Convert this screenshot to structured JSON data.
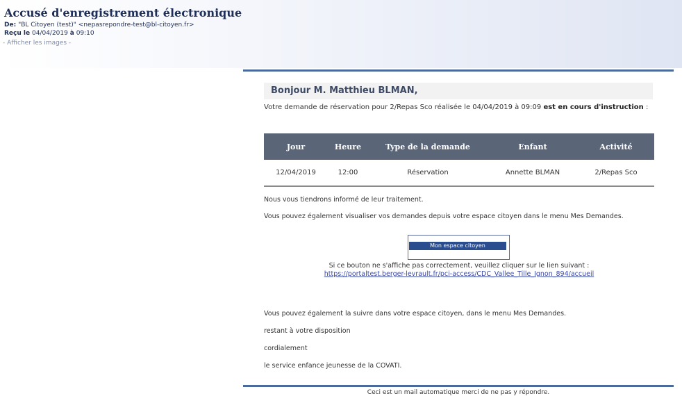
{
  "header": {
    "subject": "Accusé d'enregistrement électronique",
    "from_label": "De:",
    "from_value": "\"BL Citoyen (test)\" <nepasrepondre-test@bl-citoyen.fr>",
    "received_label": "Reçu le",
    "received_date": "04/04/2019",
    "received_at_label": "à",
    "received_time": "09:10",
    "show_images": "- Afficher les images -"
  },
  "mail": {
    "greeting": "Bonjour M. Matthieu BLMAN,",
    "intro_text": "Votre demande de réservation pour 2/Repas Sco réalisée le 04/04/2019 à 09:09",
    "intro_bold": "est en cours d'instruction",
    "intro_end": " :",
    "table": {
      "headers": [
        "Jour",
        "Heure",
        "Type de la demande",
        "Enfant",
        "Activité"
      ],
      "rows": [
        [
          "12/04/2019",
          "12:00",
          "Réservation",
          "Annette BLMAN",
          "2/Repas Sco"
        ]
      ]
    },
    "inform": "Nous vous tiendrons informé de leur traitement.",
    "visualize": "Vous pouvez également visualiser vos demandes depuis votre espace citoyen dans le menu Mes Demandes.",
    "cta_label": "Mon espace citoyen",
    "fallback_note": "Si ce bouton ne s'affiche pas correctement, veuillez cliquer sur le lien suivant :",
    "fallback_link": "https://portaltest.berger-levrault.fr/pci-access/CDC_Vallee_Tille_Ignon_894/accueil",
    "follow": "Vous pouvez également la suivre dans votre espace citoyen, dans le menu Mes Demandes.",
    "available": "restant à votre disposition",
    "regards": "cordialement",
    "signature": "le service enfance jeunesse de la COVATI.",
    "footer": "Ceci est un mail automatique merci de ne pas y répondre."
  }
}
